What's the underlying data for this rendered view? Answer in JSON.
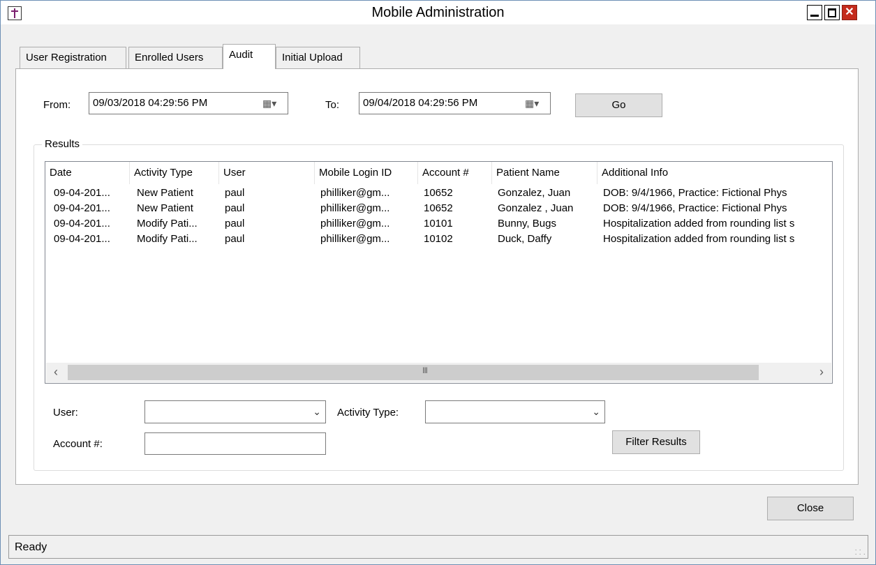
{
  "window": {
    "title": "Mobile Administration",
    "close_glyph": "✕"
  },
  "tabs": [
    "User Registration",
    "Enrolled Users",
    "Audit",
    "Initial Upload"
  ],
  "date_range": {
    "from_label": "From:",
    "from_value": "09/03/2018 04:29:56 PM",
    "to_label": "To:",
    "to_value": "09/04/2018 04:29:56 PM",
    "go_label": "Go"
  },
  "results": {
    "group_title": "Results",
    "columns": [
      "Date",
      "Activity Type",
      "User",
      "Mobile Login ID",
      "Account #",
      "Patient Name",
      "Additional Info"
    ],
    "rows": [
      [
        "09-04-201...",
        "New Patient",
        "paul",
        "philliker@gm...",
        "10652",
        "Gonzalez, Juan",
        "DOB: 9/4/1966, Practice: Fictional Phys"
      ],
      [
        "09-04-201...",
        "New Patient",
        "paul",
        "philliker@gm...",
        "10652",
        "Gonzalez , Juan",
        "DOB: 9/4/1966, Practice: Fictional Phys"
      ],
      [
        "09-04-201...",
        "Modify Pati...",
        "paul",
        "philliker@gm...",
        "10101",
        "Bunny, Bugs",
        "Hospitalization added from rounding list s"
      ],
      [
        "09-04-201...",
        "Modify Pati...",
        "paul",
        "philliker@gm...",
        "10102",
        "Duck, Daffy",
        "Hospitalization added from rounding list s"
      ]
    ],
    "scroll_grip": "III"
  },
  "filters": {
    "user_label": "User:",
    "user_value": "",
    "activity_label": "Activity Type:",
    "activity_value": "",
    "account_label": "Account #:",
    "account_value": "",
    "filter_button": "Filter Results"
  },
  "close_button": "Close",
  "status_text": "Ready"
}
